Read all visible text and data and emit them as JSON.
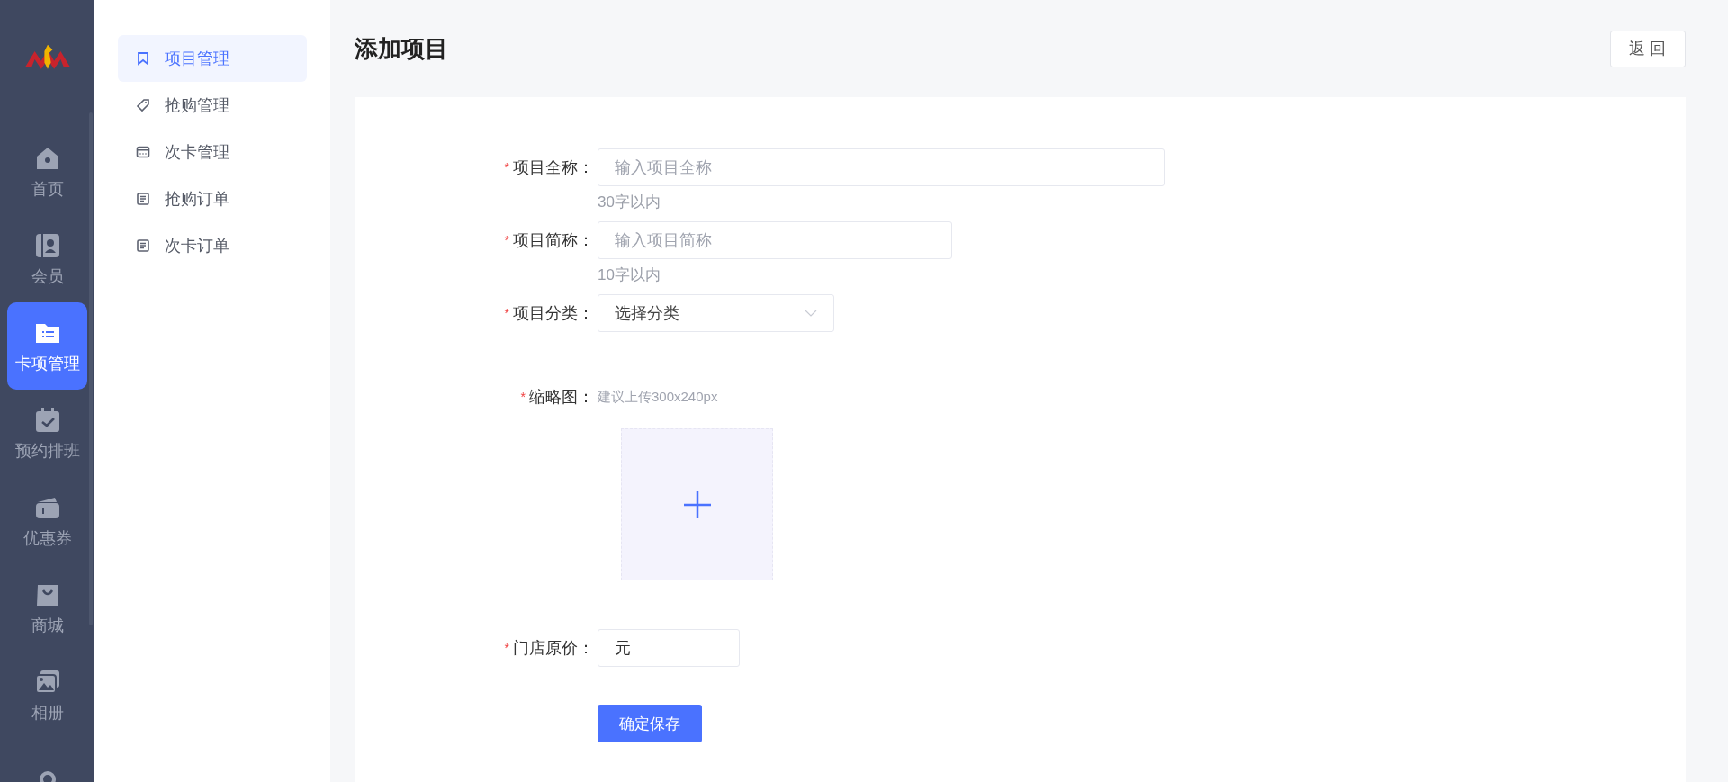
{
  "nav": [
    {
      "label": "首页",
      "selected": false
    },
    {
      "label": "会员",
      "selected": false
    },
    {
      "label": "卡项管理",
      "selected": true
    },
    {
      "label": "预约排班",
      "selected": false
    },
    {
      "label": "优惠券",
      "selected": false
    },
    {
      "label": "商城",
      "selected": false
    },
    {
      "label": "相册",
      "selected": false
    },
    {
      "selected": false
    }
  ],
  "submenu": [
    {
      "label": "项目管理",
      "selected": true
    },
    {
      "label": "抢购管理",
      "selected": false
    },
    {
      "label": "次卡管理",
      "selected": false
    },
    {
      "label": "抢购订单",
      "selected": false
    },
    {
      "label": "次卡订单",
      "selected": false
    }
  ],
  "page_title": "添加项目",
  "back_button": "返 回",
  "form": [
    {
      "kind": "text",
      "asterisk": "*",
      "label": "项目全称：",
      "placeholder": "输入项目全称",
      "hint": "30字以内"
    },
    {
      "kind": "text",
      "asterisk": "*",
      "label": "项目简称：",
      "placeholder": "输入项目简称",
      "hint": "10字以内"
    },
    {
      "kind": "select",
      "asterisk": "*",
      "label": "项目分类：",
      "value": "选择分类"
    },
    {
      "kind": "upload",
      "asterisk": "*",
      "label": "缩略图：",
      "hint": "建议上传300x240px"
    },
    {
      "kind": "price",
      "asterisk": "*",
      "label": "门店原价：",
      "unit": "元"
    }
  ],
  "submit_button": "确定保存"
}
